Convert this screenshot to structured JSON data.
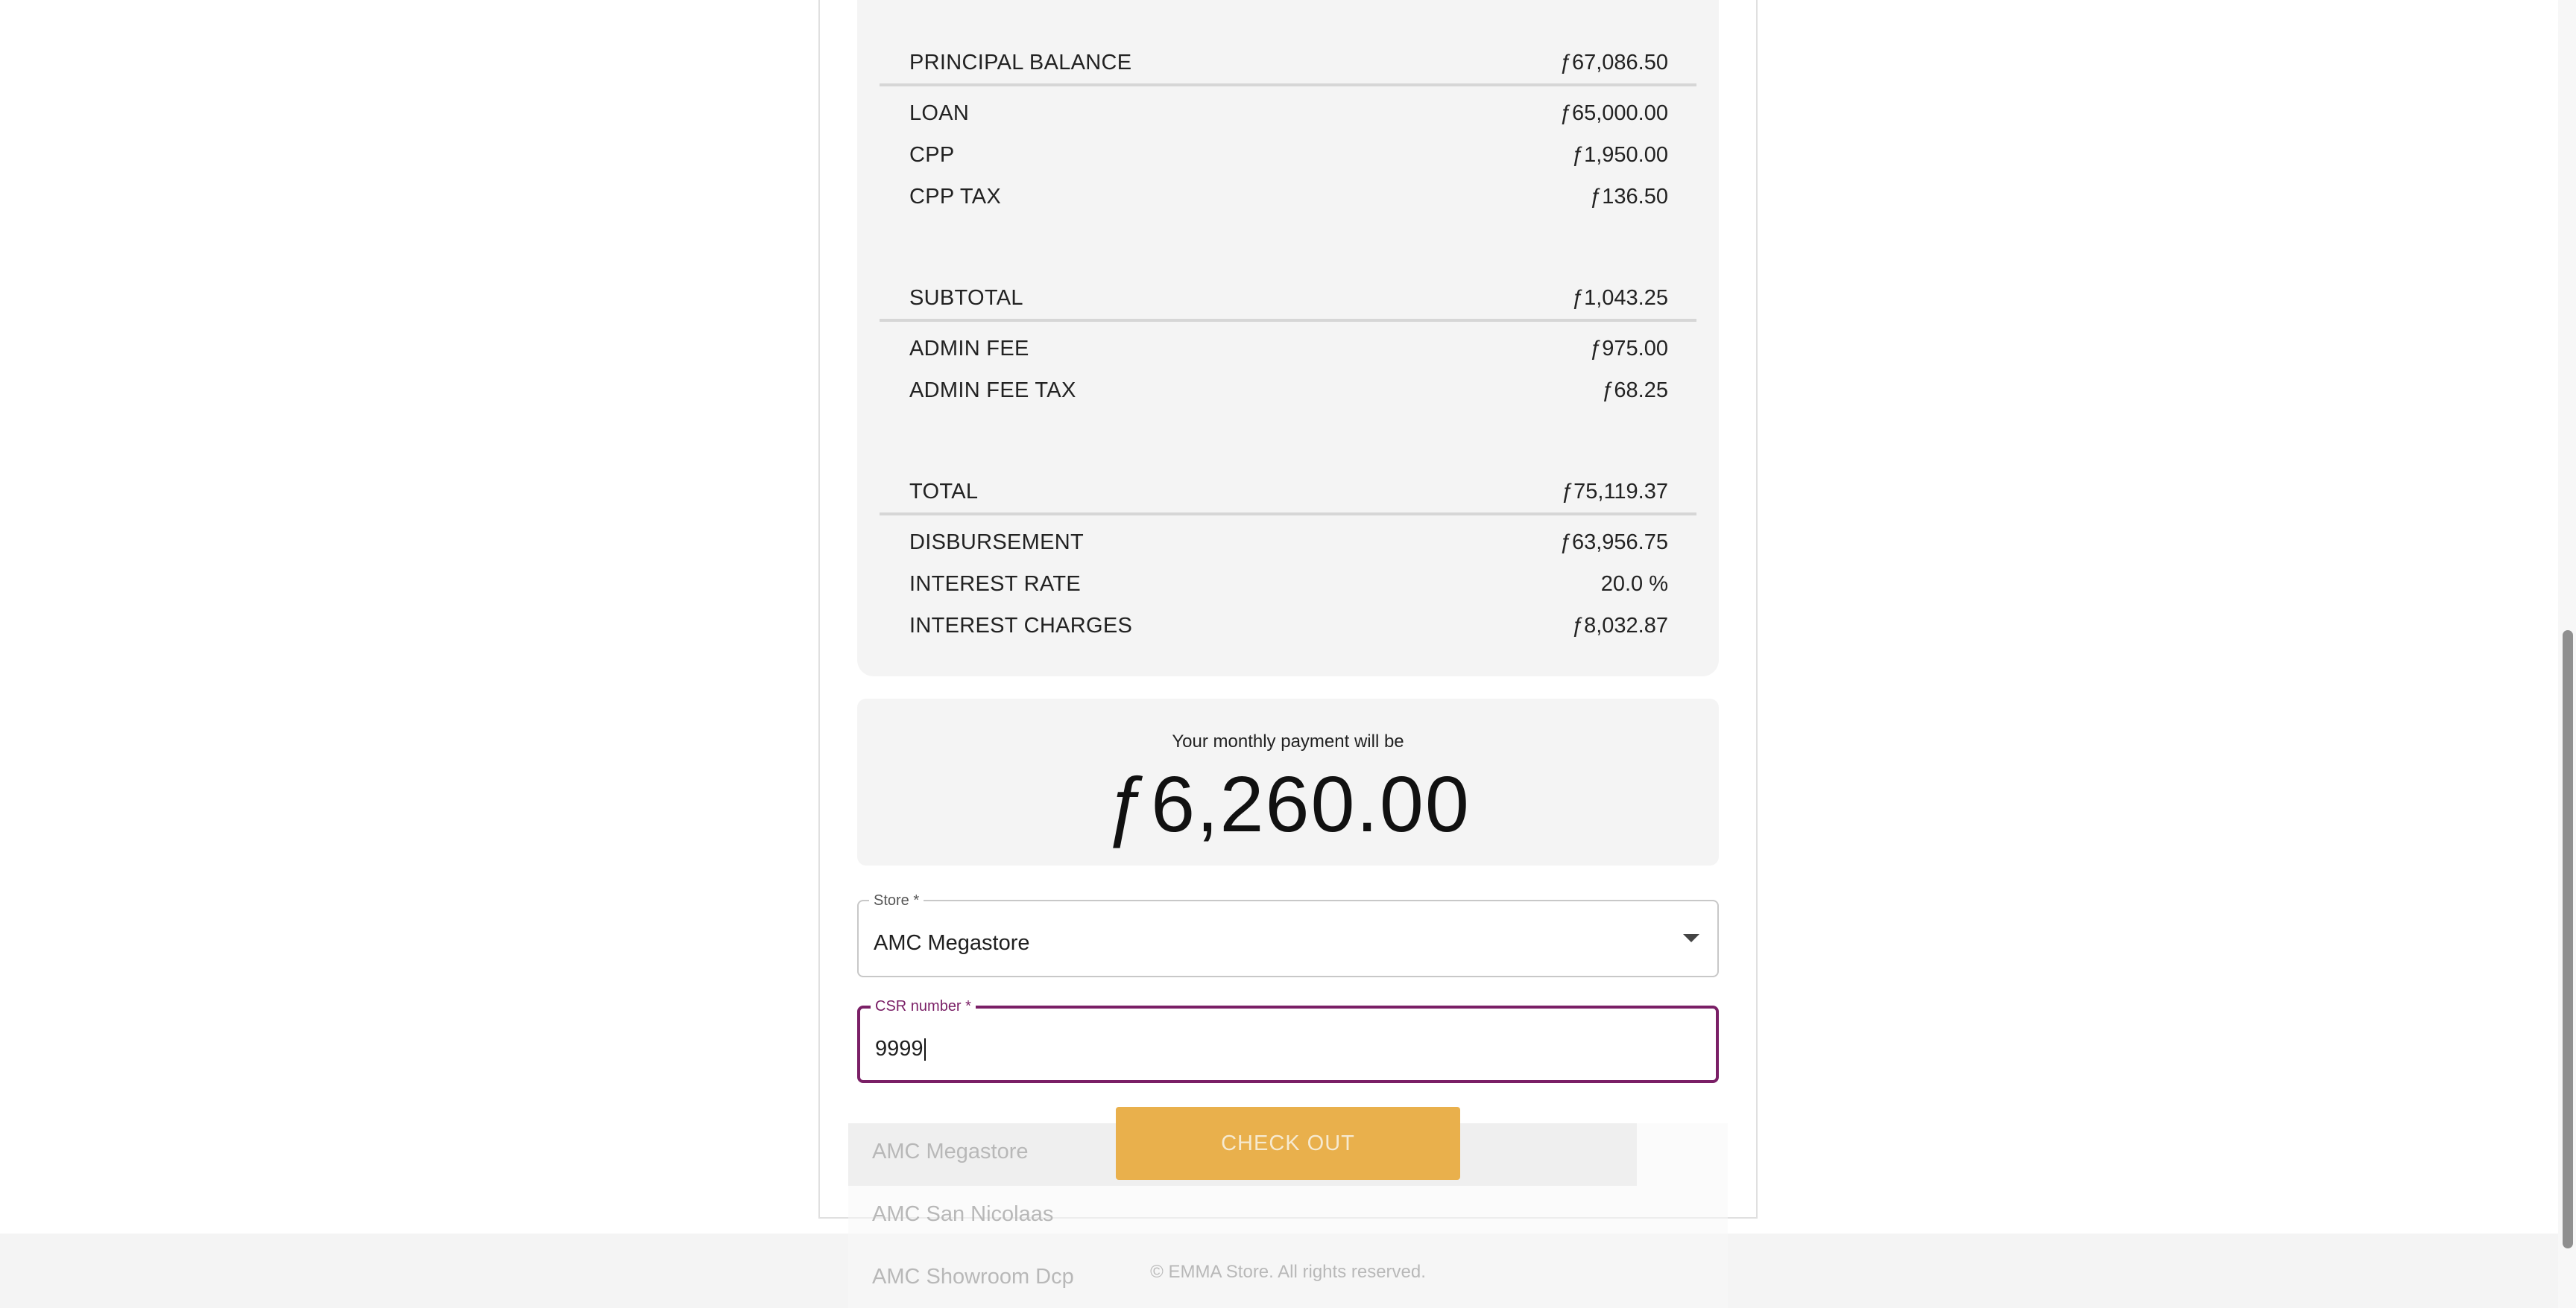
{
  "summary": {
    "principal_balance": {
      "label": "PRINCIPAL BALANCE",
      "value": "ƒ67,086.50"
    },
    "loan": {
      "label": "LOAN",
      "value": "ƒ65,000.00"
    },
    "cpp": {
      "label": "CPP",
      "value": "ƒ1,950.00"
    },
    "cpp_tax": {
      "label": "CPP TAX",
      "value": "ƒ136.50"
    },
    "subtotal": {
      "label": "SUBTOTAL",
      "value": "ƒ1,043.25"
    },
    "admin_fee": {
      "label": "ADMIN FEE",
      "value": "ƒ975.00"
    },
    "admin_fee_tax": {
      "label": "ADMIN FEE TAX",
      "value": "ƒ68.25"
    },
    "total": {
      "label": "TOTAL",
      "value": "ƒ75,119.37"
    },
    "disbursement": {
      "label": "DISBURSEMENT",
      "value": "ƒ63,956.75"
    },
    "interest_rate": {
      "label": "INTEREST RATE",
      "value": "20.0 %"
    },
    "interest_charges": {
      "label": "INTEREST CHARGES",
      "value": "ƒ8,032.87"
    }
  },
  "monthly": {
    "caption": "Your monthly payment will be",
    "amount": "ƒ6,260.00"
  },
  "store_field": {
    "label": "Store *",
    "value": "AMC Megastore",
    "icon": "chevron-down-icon"
  },
  "csr_field": {
    "label": "CSR number *",
    "value": "9999"
  },
  "store_options": [
    "AMC Megastore",
    "AMC San Nicolaas",
    "AMC Showroom Dcp"
  ],
  "checkout_label": "CHECK OUT",
  "footer_text": "© EMMA Store. All rights reserved.",
  "colors": {
    "accent": "#7a1f66",
    "button": "#e9b04c",
    "panel": "#f4f4f4"
  }
}
